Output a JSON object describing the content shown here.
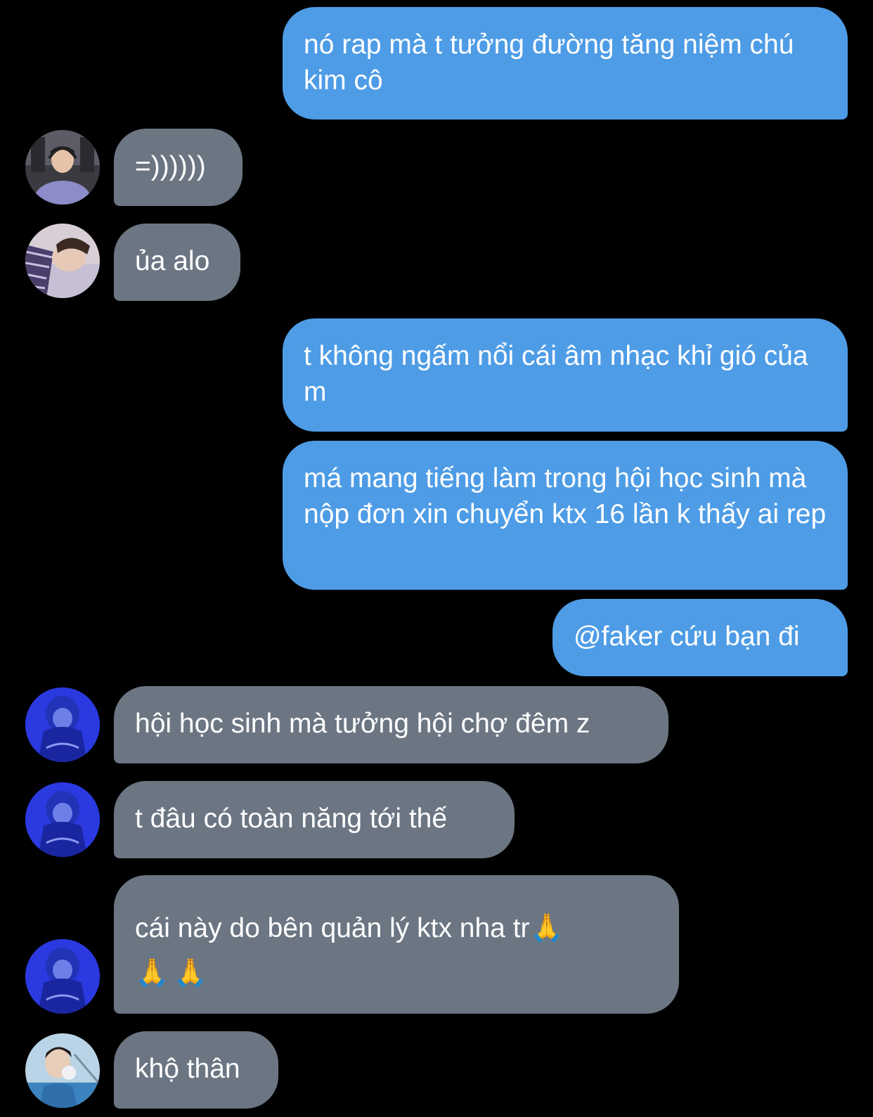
{
  "messages": [
    {
      "side": "out",
      "text": "nó rap mà t tưởng đường tăng niệm chú kim cô"
    },
    {
      "side": "in",
      "avatar": "gamer-avatar",
      "text": "=))))))"
    },
    {
      "side": "in",
      "avatar": "sleeping-avatar",
      "text": "ủa alo"
    },
    {
      "side": "out",
      "text": "t không ngấm nổi cái âm nhạc khỉ gió của m"
    },
    {
      "side": "out",
      "text": "má mang tiếng làm trong hội học sinh mà nộp đơn xin chuyển ktx 16 lần k thấy ai rep"
    },
    {
      "side": "out",
      "text": "@faker cứu bạn đi"
    },
    {
      "side": "in",
      "avatar": "blue-hood-avatar",
      "text": "hội học sinh mà tưởng hội chợ đêm z"
    },
    {
      "side": "in",
      "avatar": "blue-hood-avatar",
      "text": "t đâu có toàn năng tới thế"
    },
    {
      "side": "in",
      "avatar": "blue-hood-avatar",
      "text": "cái này do bên quản lý ktx nha tr",
      "emoji_inline": "🙏",
      "emoji_line": "🙏🙏"
    },
    {
      "side": "in",
      "avatar": "bubblegum-avatar",
      "text": "khộ thân"
    }
  ],
  "colors": {
    "background": "#000000",
    "outgoing_bubble": "#4e9ce6",
    "incoming_bubble": "#6c7683",
    "text": "#ffffff"
  }
}
